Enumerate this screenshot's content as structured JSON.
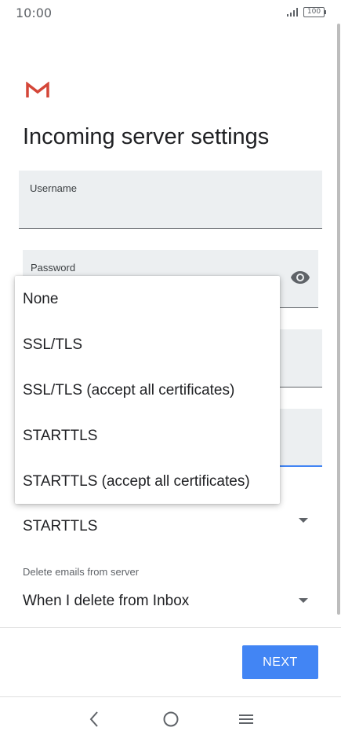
{
  "status_bar": {
    "time": "10:00",
    "battery": "100"
  },
  "page": {
    "title": "Incoming server settings"
  },
  "fields": {
    "username_label": "Username",
    "password_label": "Password"
  },
  "security": {
    "selected": "STARTTLS"
  },
  "delete_policy": {
    "label": "Delete emails from server",
    "selected": "When I delete from Inbox"
  },
  "actions": {
    "next_label": "NEXT"
  },
  "security_menu": {
    "options": [
      "None",
      "SSL/TLS",
      "SSL/TLS (accept all certificates)",
      "STARTTLS",
      "STARTTLS (accept all certificates)"
    ]
  },
  "colors": {
    "accent": "#4285f4",
    "gmail_red": "#d44638"
  },
  "icons": [
    "gmail-logo",
    "eye-icon",
    "caret-down-icon",
    "back-icon",
    "home-icon",
    "recents-icon"
  ]
}
